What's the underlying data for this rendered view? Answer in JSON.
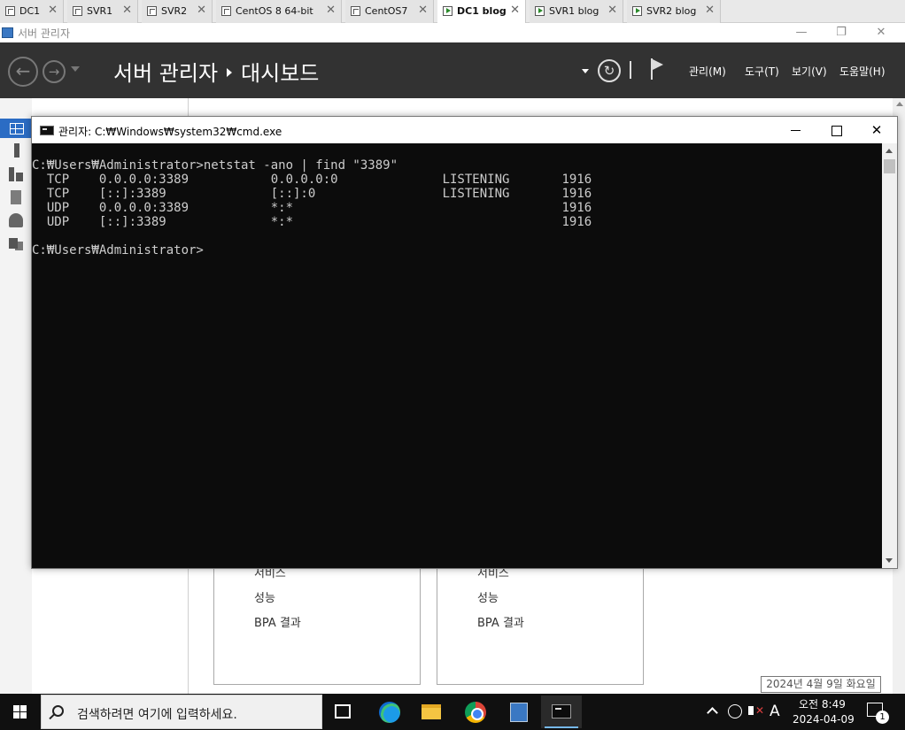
{
  "vm_tabs": [
    {
      "label": "DC1",
      "active": false,
      "icon": "vm-icon"
    },
    {
      "label": "SVR1",
      "active": false,
      "icon": "vm-icon"
    },
    {
      "label": "SVR2",
      "active": false,
      "icon": "vm-icon"
    },
    {
      "label": "CentOS 8 64-bit",
      "active": false,
      "icon": "vm-icon"
    },
    {
      "label": "CentOS7",
      "active": false,
      "icon": "vm-icon"
    },
    {
      "label": "DC1 blog",
      "active": true,
      "icon": "vm-running-icon"
    },
    {
      "label": "SVR1 blog",
      "active": false,
      "icon": "vm-running-icon"
    },
    {
      "label": "SVR2 blog",
      "active": false,
      "icon": "vm-running-icon"
    }
  ],
  "server_manager": {
    "window_title": "서버 관리자",
    "breadcrumb_root": "서버 관리자",
    "breadcrumb_page": "대시보드",
    "menus": [
      "관리(M)",
      "도구(T)",
      "보기(V)",
      "도움말(H)"
    ],
    "tiles": [
      {
        "items": [
          "서비스",
          "성능",
          "BPA 결과"
        ]
      },
      {
        "items": [
          "서비스",
          "성능",
          "BPA 결과"
        ]
      }
    ],
    "date_tooltip": "2024년 4월 9일 화요일"
  },
  "cmd": {
    "title": "관리자: C:₩Windows₩system32₩cmd.exe",
    "lines": [
      "C:₩Users₩Administrator>netstat -ano | find \"3389\"",
      "  TCP    0.0.0.0:3389           0.0.0.0:0              LISTENING       1916",
      "  TCP    [::]:3389              [::]:0                 LISTENING       1916",
      "  UDP    0.0.0.0:3389           *:*                                    1916",
      "  UDP    [::]:3389              *:*                                    1916",
      "",
      "C:₩Users₩Administrator>"
    ]
  },
  "taskbar": {
    "search_placeholder": "검색하려면 여기에 입력하세요.",
    "ime_indicator": "A",
    "time": "오전 8:49",
    "date": "2024-04-09",
    "notification_count": "1"
  },
  "colors": {
    "header_bg": "#323232",
    "console_bg": "#0c0c0c",
    "console_fg": "#cccccc",
    "selection_blue": "#2b6cc4",
    "taskbar_bg": "#101010"
  }
}
